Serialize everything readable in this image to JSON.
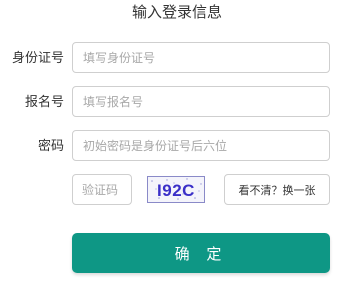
{
  "form": {
    "title": "输入登录信息",
    "id_number": {
      "label": "身份证号",
      "placeholder": "填写身份证号",
      "value": ""
    },
    "registration_number": {
      "label": "报名号",
      "placeholder": "填写报名号",
      "value": ""
    },
    "password": {
      "label": "密码",
      "placeholder": "初始密码是身份证号后六位",
      "value": ""
    },
    "captcha": {
      "placeholder": "验证码",
      "value": "",
      "image_text": "I92C",
      "refresh_label": "看不清？换一张"
    },
    "submit_label": "确 定"
  },
  "colors": {
    "accent": "#0e9785",
    "captcha_text": "#3a2fc8",
    "input_border": "#cfcfcf"
  }
}
